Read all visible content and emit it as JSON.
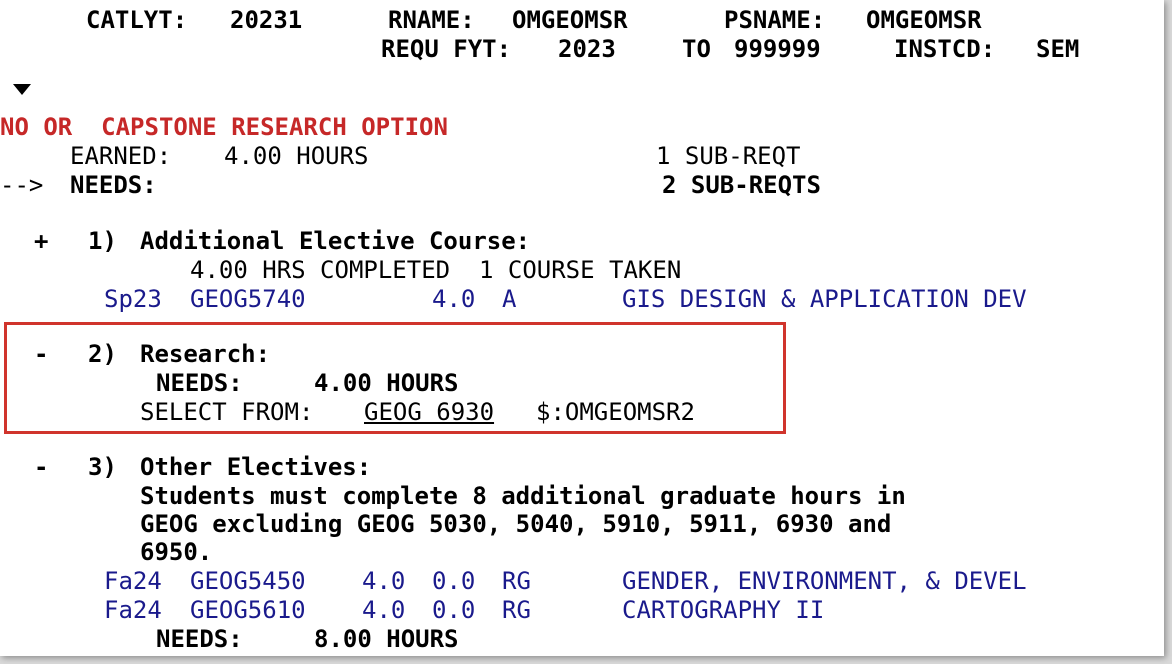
{
  "header": {
    "catlyt_label": "CATLYT:",
    "catlyt_value": "20231",
    "rname_label": "RNAME:",
    "rname_value": "OMGEOMSR",
    "psname_label": "PSNAME:",
    "psname_value": "OMGEOMSR",
    "requ_label": "REQU FYT:",
    "requ_value": "2023",
    "to_label": "TO",
    "to_value": "999999",
    "instcd_label": "INSTCD:",
    "instcd_value": "SEM"
  },
  "requirement": {
    "title": "NO OR  CAPSTONE RESEARCH OPTION",
    "earned_label": "EARNED:",
    "earned_value": "4.00 HOURS",
    "earned_subreqs": "1 SUB-REQT",
    "needs_arrow": "-->",
    "needs_label": "NEEDS:",
    "needs_subreqs": "2 SUB-REQTS"
  },
  "sub1": {
    "marker": "+",
    "number": "1)",
    "title": "Additional Elective Course:",
    "completed": "4.00 HRS COMPLETED  1 COURSE TAKEN",
    "courses": [
      {
        "term": "Sp23",
        "course": "GEOG5740",
        "credits": "4.0",
        "grade": "A",
        "title": "GIS DESIGN & APPLICATION DEV"
      }
    ]
  },
  "sub2": {
    "marker": "-",
    "number": "2)",
    "title": "Research:",
    "needs_label": "NEEDS:",
    "needs_value": "4.00 HOURS",
    "select_label": "SELECT FROM:",
    "select_course": "GEOG 6930",
    "select_code": "$:OMGEOMSR2"
  },
  "sub3": {
    "marker": "-",
    "number": "3)",
    "title": "Other Electives:",
    "desc_line1": "Students must complete 8 additional graduate hours in",
    "desc_line2": "GEOG excluding GEOG 5030, 5040, 5910, 5911, 6930 and",
    "desc_line3": "6950.",
    "courses": [
      {
        "term": "Fa24",
        "course": "GEOG5450",
        "credits": "4.0",
        "earned": "0.0",
        "grade": "RG",
        "title": "GENDER, ENVIRONMENT, & DEVEL"
      },
      {
        "term": "Fa24",
        "course": "GEOG5610",
        "credits": "4.0",
        "earned": "0.0",
        "grade": "RG",
        "title": "CARTOGRAPHY II"
      }
    ],
    "needs_label": "NEEDS:",
    "needs_value": "8.00 HOURS"
  },
  "colors": {
    "title_red": "#c62828",
    "course_navy": "#1a1a8c",
    "highlight_border": "#d0342c"
  }
}
